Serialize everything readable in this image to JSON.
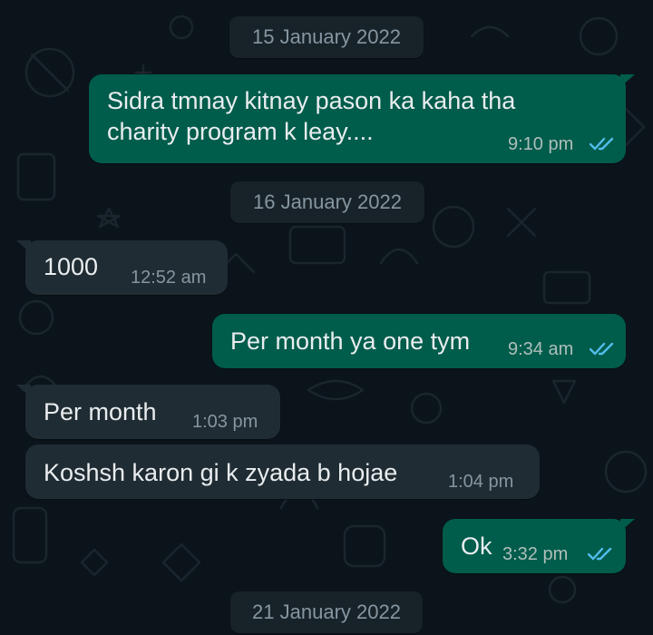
{
  "colors": {
    "background": "#0b141a",
    "incoming_bubble": "#202c33",
    "outgoing_bubble": "#005c4b",
    "date_chip": "#182229",
    "read_ticks": "#53bdeb"
  },
  "icons": {
    "read_receipt": "double-check-read-icon"
  },
  "chat": {
    "dates": [
      "15 January 2022",
      "16 January 2022",
      "21 January 2022"
    ],
    "messages": [
      {
        "direction": "outgoing",
        "lines": [
          "Sidra tmnay kitnay pason ka kaha tha",
          "charity program k leay...."
        ],
        "time": "9:10 pm",
        "status": "read"
      },
      {
        "direction": "incoming",
        "lines": [
          "1000"
        ],
        "time": "12:52 am"
      },
      {
        "direction": "outgoing",
        "lines": [
          "Per month ya one tym"
        ],
        "time": "9:34 am",
        "status": "read"
      },
      {
        "direction": "incoming",
        "lines": [
          "Per month"
        ],
        "time": "1:03 pm"
      },
      {
        "direction": "incoming",
        "lines": [
          "Koshsh karon gi k zyada b hojae"
        ],
        "time": "1:04 pm"
      },
      {
        "direction": "outgoing",
        "lines": [
          "Ok"
        ],
        "time": "3:32 pm",
        "status": "read"
      }
    ]
  }
}
